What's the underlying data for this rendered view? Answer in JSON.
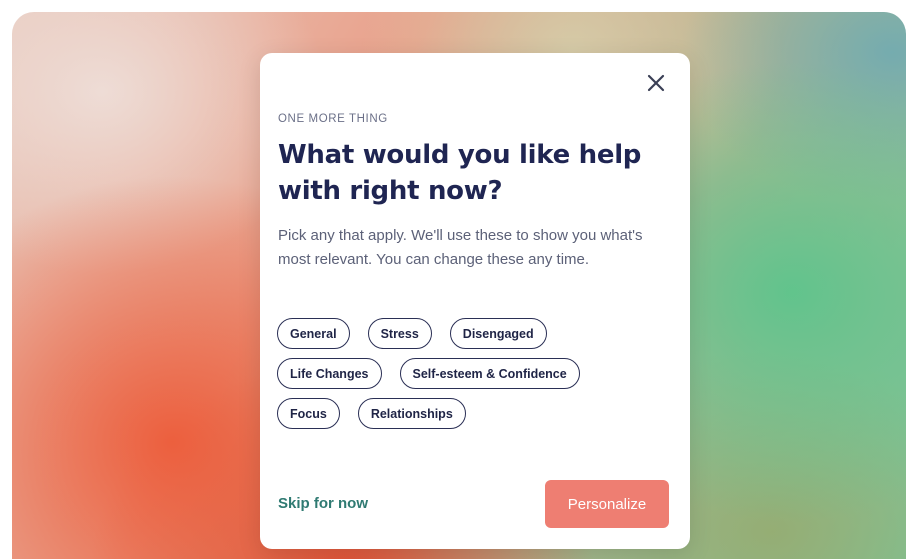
{
  "modal": {
    "eyebrow": "ONE MORE THING",
    "title": "What would you like help with right now?",
    "description": "Pick any that apply. We'll use these to show you what's most relevant. You can change these any time.",
    "close_icon": "close-x-icon",
    "chip_rows": [
      [
        "General",
        "Stress",
        "Disengaged"
      ],
      [
        "Life Changes",
        "Self-esteem & Confidence"
      ],
      [
        "Focus",
        "Relationships"
      ]
    ],
    "skip_label": "Skip for now",
    "personalize_label": "Personalize"
  },
  "colors": {
    "title": "#1f2552",
    "chip_border": "#2a2f55",
    "skip_link": "#2f7a72",
    "primary_button": "#ee7e72"
  }
}
